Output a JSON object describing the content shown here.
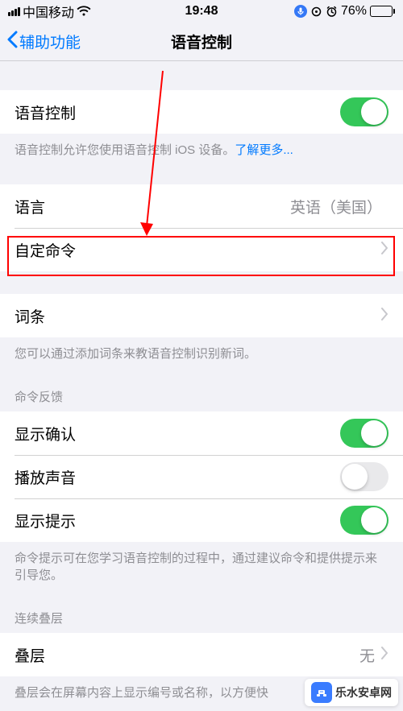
{
  "status": {
    "carrier": "中国移动",
    "time": "19:48",
    "battery_pct": "76%"
  },
  "nav": {
    "back": "辅助功能",
    "title": "语音控制"
  },
  "rows": {
    "voice_control": "语音控制",
    "voice_control_footer": "语音控制允许您使用语音控制 iOS 设备。",
    "learn_more": "了解更多...",
    "language": "语言",
    "language_value": "英语（美国）",
    "custom_commands": "自定命令",
    "vocabulary": "词条",
    "vocabulary_footer": "您可以通过添加词条来教语音控制识别新词。",
    "feedback_header": "命令反馈",
    "show_confirm": "显示确认",
    "play_sound": "播放声音",
    "show_hints": "显示提示",
    "hints_footer": "命令提示可在您学习语音控制的过程中，通过建议命令和提供提示来引导您。",
    "overlay_header": "连续叠层",
    "overlay": "叠层",
    "overlay_value": "无",
    "overlay_footer": "叠层会在屏幕内容上显示编号或名称，以方便快"
  },
  "watermark": "乐水安卓网"
}
